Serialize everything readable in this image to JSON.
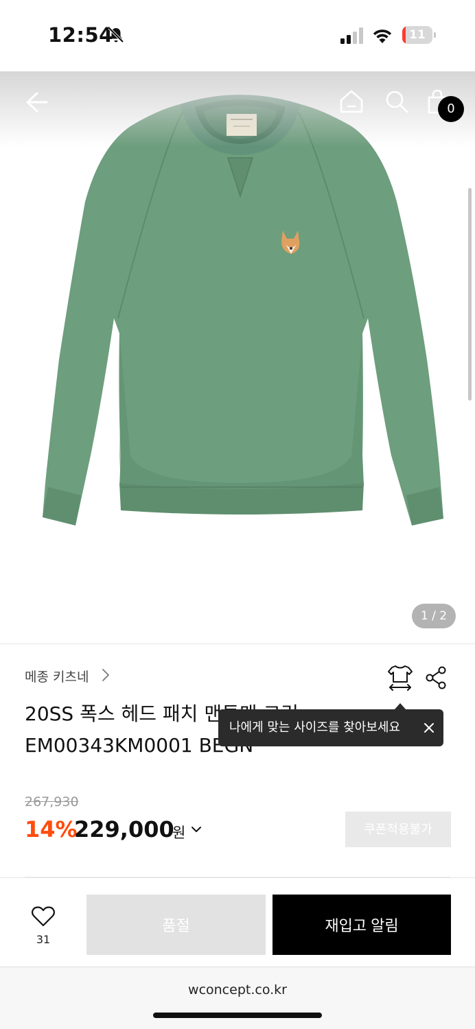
{
  "status_bar": {
    "time": "12:54",
    "battery_level": "11",
    "battery_fraction": 0.11,
    "icons": [
      "bell-slash-icon",
      "cellular-signal-icon",
      "wifi-icon",
      "battery-icon"
    ]
  },
  "header": {
    "icons": [
      "back-arrow-icon",
      "home-icon",
      "search-icon",
      "shopping-bag-icon"
    ],
    "cart_count": "0"
  },
  "gallery": {
    "pager": "1 / 2"
  },
  "product": {
    "brand": "메종 키츠네",
    "name_line1": "20SS 폭스 헤드 패치 맨투맨 그린",
    "name_line2": "EM00343KM0001 BEGN",
    "original_price": "267,930",
    "discount_rate": "14%",
    "sale_price": "229,000",
    "currency": "원",
    "coupon_label": "쿠폰적용불가"
  },
  "tooltip": {
    "text": "나에게 맞는 사이즈를 찾아보세요"
  },
  "actions": {
    "like_count": "31",
    "soldout_label": "품절",
    "restock_label": "재입고 알림"
  },
  "browser": {
    "url": "wconcept.co.kr"
  },
  "colors": {
    "discount": "#ff4c0d",
    "product_green": "#6d9e7d",
    "badge": "#000000"
  }
}
